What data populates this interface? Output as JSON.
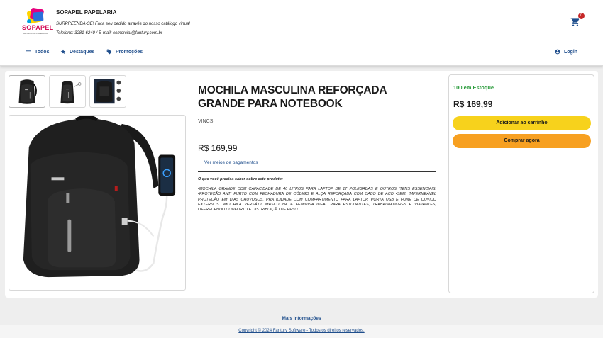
{
  "header": {
    "logo_text": "SOPAPEL",
    "logo_subtext": "ARTIGOS DE PAPELARIA",
    "store_name": "SOPAPEL PAPELARIA",
    "tagline": "SURPREENDA-SE! Faça seu pedido através do nosso catálogo virtual",
    "contact": "Telefone: 3281-6240 / E-mail: comercial@fantury.com.br",
    "cart_count": "0",
    "nav": {
      "todos": "Todos",
      "destaques": "Destaques",
      "promocoes": "Promoções",
      "login": "Login"
    }
  },
  "product": {
    "title": "MOCHILA MASCULINA REFORÇADA GRANDE PARA NOTEBOOK",
    "brand": "VINCS",
    "price": "R$ 169,99",
    "payment_link": "Ver meios de pagamentos",
    "description_heading": "O que você precisa saber sobre este produto:",
    "description": "•MOCHILA GRANDE COM CAPACIDADE DE 40 LITROS PARA LAPTOP DE 17 POLEGADAS E OUTROS ITENS ESSENCIAIS. •PROTEÇÃO ANTI FURTO COM FECHADURA DE CÓDIGO E ALÇA REFORÇADA COM CABO DE AÇO •SEMI IMPERMEÁVEL PROTEÇÃO EM DIAS CHUVOSOS. PRATICIDADE COM COMPARTIMENTO PARA LAPTOP. PORTA USB E FONE DE OUVIDO EXTERNOS. •MOCHILA VERSÁTIL MASCULINA E FEMININA IDEAL PARA ESTUDANTES, TRABALHADORES E VIAJANTES, OFERECENDO CONFORTO E DISTRIBUIÇÃO DE PESO."
  },
  "buybox": {
    "stock": "100 em Estoque",
    "price": "R$ 169,99",
    "add_to_cart": "Adicionar ao carrinho",
    "buy_now": "Comprar agora"
  },
  "footer": {
    "more_info": "Mais informações",
    "copyright": "Copyright © 2024 Fantury Software - Todos os direitos reservados."
  },
  "colors": {
    "link": "#1f4e8c",
    "stock": "#2e9d3f",
    "add_to_cart": "#f7d21c",
    "buy_now": "#f7a021",
    "badge": "#c62828"
  },
  "icons": {
    "cart": "shopping-cart-icon",
    "todos": "grid-icon",
    "destaques": "star-icon",
    "promocoes": "tag-icon",
    "login": "account-circle-icon"
  }
}
